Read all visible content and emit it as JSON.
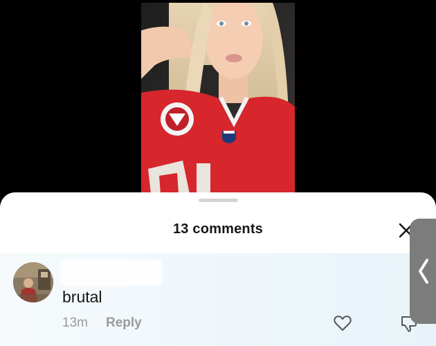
{
  "video": {
    "description_icon": "video-thumbnail-image"
  },
  "comments_sheet": {
    "title": "13 comments",
    "close_icon": "close-icon"
  },
  "comment": {
    "username": "",
    "text": "brutal",
    "time": "13m",
    "reply_label": "Reply",
    "like_icon": "heart-icon",
    "dislike_icon": "thumbs-down-icon"
  },
  "side_handle": {
    "icon": "chevron-left-icon"
  },
  "colors": {
    "background": "#000000",
    "sheet": "#ffffff",
    "highlight_row": "#e8f3f9",
    "muted_text": "#9a9a9a",
    "primary_text": "#161616",
    "jersey_red": "#d7262c"
  }
}
